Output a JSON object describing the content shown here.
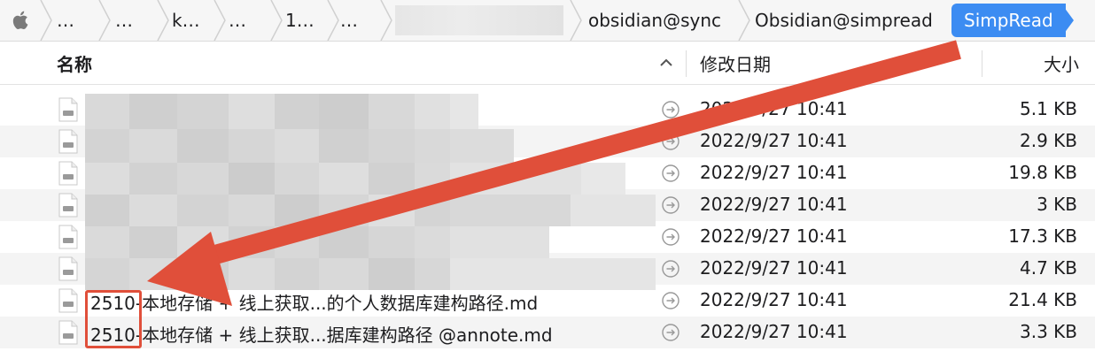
{
  "path_bar": {
    "crumbs": [
      "…",
      "…",
      "k…",
      "…",
      "1…",
      "…"
    ],
    "obscured_crumb": "",
    "crumb_sync": "obsidian@sync",
    "crumb_simpread": "Obsidian@simpread",
    "crumb_current": "SimpRead"
  },
  "columns": {
    "name": "名称",
    "date_modified": "修改日期",
    "size": "大小"
  },
  "files": [
    {
      "name": "",
      "date": "2022/9/27 10:41",
      "size": "5.1 KB"
    },
    {
      "name": "",
      "date": "2022/9/27 10:41",
      "size": "2.9 KB"
    },
    {
      "name": "",
      "date": "2022/9/27 10:41",
      "size": "19.8 KB"
    },
    {
      "name": "",
      "date": "2022/9/27 10:41",
      "size": "3 KB"
    },
    {
      "name": "",
      "date": "2022/9/27 10:41",
      "size": "17.3 KB"
    },
    {
      "name": "",
      "date": "2022/9/27 10:41",
      "size": "4.7 KB"
    },
    {
      "name": "2510-本地存储 + 线上获取...的个人数据库建构路径.md",
      "date": "2022/9/27 10:41",
      "size": "21.4 KB"
    },
    {
      "name": "2510-本地存储 + 线上获取...据库建构路径 @annote.md",
      "date": "2022/9/27 10:41",
      "size": "3.3 KB"
    }
  ],
  "icons": {
    "apple": "apple-icon",
    "file": "markdown-file-icon",
    "go": "go-to-arrow-icon",
    "sort": "sort-ascending-icon"
  },
  "colors": {
    "accent": "#3c8cf2",
    "annotation": "#e04f3a",
    "row_alt": "#f4f4f4"
  }
}
